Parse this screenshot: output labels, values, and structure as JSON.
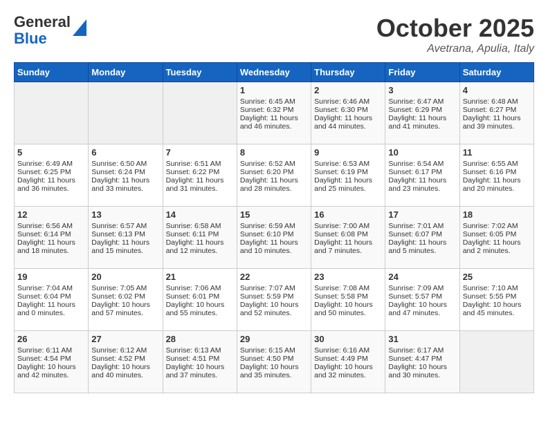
{
  "header": {
    "logo_line1": "General",
    "logo_line2": "Blue",
    "month": "October 2025",
    "location": "Avetrana, Apulia, Italy"
  },
  "days_of_week": [
    "Sunday",
    "Monday",
    "Tuesday",
    "Wednesday",
    "Thursday",
    "Friday",
    "Saturday"
  ],
  "weeks": [
    [
      {
        "day": "",
        "sunrise": "",
        "sunset": "",
        "daylight": ""
      },
      {
        "day": "",
        "sunrise": "",
        "sunset": "",
        "daylight": ""
      },
      {
        "day": "",
        "sunrise": "",
        "sunset": "",
        "daylight": ""
      },
      {
        "day": "1",
        "sunrise": "Sunrise: 6:45 AM",
        "sunset": "Sunset: 6:32 PM",
        "daylight": "Daylight: 11 hours and 46 minutes."
      },
      {
        "day": "2",
        "sunrise": "Sunrise: 6:46 AM",
        "sunset": "Sunset: 6:30 PM",
        "daylight": "Daylight: 11 hours and 44 minutes."
      },
      {
        "day": "3",
        "sunrise": "Sunrise: 6:47 AM",
        "sunset": "Sunset: 6:29 PM",
        "daylight": "Daylight: 11 hours and 41 minutes."
      },
      {
        "day": "4",
        "sunrise": "Sunrise: 6:48 AM",
        "sunset": "Sunset: 6:27 PM",
        "daylight": "Daylight: 11 hours and 39 minutes."
      }
    ],
    [
      {
        "day": "5",
        "sunrise": "Sunrise: 6:49 AM",
        "sunset": "Sunset: 6:25 PM",
        "daylight": "Daylight: 11 hours and 36 minutes."
      },
      {
        "day": "6",
        "sunrise": "Sunrise: 6:50 AM",
        "sunset": "Sunset: 6:24 PM",
        "daylight": "Daylight: 11 hours and 33 minutes."
      },
      {
        "day": "7",
        "sunrise": "Sunrise: 6:51 AM",
        "sunset": "Sunset: 6:22 PM",
        "daylight": "Daylight: 11 hours and 31 minutes."
      },
      {
        "day": "8",
        "sunrise": "Sunrise: 6:52 AM",
        "sunset": "Sunset: 6:20 PM",
        "daylight": "Daylight: 11 hours and 28 minutes."
      },
      {
        "day": "9",
        "sunrise": "Sunrise: 6:53 AM",
        "sunset": "Sunset: 6:19 PM",
        "daylight": "Daylight: 11 hours and 25 minutes."
      },
      {
        "day": "10",
        "sunrise": "Sunrise: 6:54 AM",
        "sunset": "Sunset: 6:17 PM",
        "daylight": "Daylight: 11 hours and 23 minutes."
      },
      {
        "day": "11",
        "sunrise": "Sunrise: 6:55 AM",
        "sunset": "Sunset: 6:16 PM",
        "daylight": "Daylight: 11 hours and 20 minutes."
      }
    ],
    [
      {
        "day": "12",
        "sunrise": "Sunrise: 6:56 AM",
        "sunset": "Sunset: 6:14 PM",
        "daylight": "Daylight: 11 hours and 18 minutes."
      },
      {
        "day": "13",
        "sunrise": "Sunrise: 6:57 AM",
        "sunset": "Sunset: 6:13 PM",
        "daylight": "Daylight: 11 hours and 15 minutes."
      },
      {
        "day": "14",
        "sunrise": "Sunrise: 6:58 AM",
        "sunset": "Sunset: 6:11 PM",
        "daylight": "Daylight: 11 hours and 12 minutes."
      },
      {
        "day": "15",
        "sunrise": "Sunrise: 6:59 AM",
        "sunset": "Sunset: 6:10 PM",
        "daylight": "Daylight: 11 hours and 10 minutes."
      },
      {
        "day": "16",
        "sunrise": "Sunrise: 7:00 AM",
        "sunset": "Sunset: 6:08 PM",
        "daylight": "Daylight: 11 hours and 7 minutes."
      },
      {
        "day": "17",
        "sunrise": "Sunrise: 7:01 AM",
        "sunset": "Sunset: 6:07 PM",
        "daylight": "Daylight: 11 hours and 5 minutes."
      },
      {
        "day": "18",
        "sunrise": "Sunrise: 7:02 AM",
        "sunset": "Sunset: 6:05 PM",
        "daylight": "Daylight: 11 hours and 2 minutes."
      }
    ],
    [
      {
        "day": "19",
        "sunrise": "Sunrise: 7:04 AM",
        "sunset": "Sunset: 6:04 PM",
        "daylight": "Daylight: 11 hours and 0 minutes."
      },
      {
        "day": "20",
        "sunrise": "Sunrise: 7:05 AM",
        "sunset": "Sunset: 6:02 PM",
        "daylight": "Daylight: 10 hours and 57 minutes."
      },
      {
        "day": "21",
        "sunrise": "Sunrise: 7:06 AM",
        "sunset": "Sunset: 6:01 PM",
        "daylight": "Daylight: 10 hours and 55 minutes."
      },
      {
        "day": "22",
        "sunrise": "Sunrise: 7:07 AM",
        "sunset": "Sunset: 5:59 PM",
        "daylight": "Daylight: 10 hours and 52 minutes."
      },
      {
        "day": "23",
        "sunrise": "Sunrise: 7:08 AM",
        "sunset": "Sunset: 5:58 PM",
        "daylight": "Daylight: 10 hours and 50 minutes."
      },
      {
        "day": "24",
        "sunrise": "Sunrise: 7:09 AM",
        "sunset": "Sunset: 5:57 PM",
        "daylight": "Daylight: 10 hours and 47 minutes."
      },
      {
        "day": "25",
        "sunrise": "Sunrise: 7:10 AM",
        "sunset": "Sunset: 5:55 PM",
        "daylight": "Daylight: 10 hours and 45 minutes."
      }
    ],
    [
      {
        "day": "26",
        "sunrise": "Sunrise: 6:11 AM",
        "sunset": "Sunset: 4:54 PM",
        "daylight": "Daylight: 10 hours and 42 minutes."
      },
      {
        "day": "27",
        "sunrise": "Sunrise: 6:12 AM",
        "sunset": "Sunset: 4:52 PM",
        "daylight": "Daylight: 10 hours and 40 minutes."
      },
      {
        "day": "28",
        "sunrise": "Sunrise: 6:13 AM",
        "sunset": "Sunset: 4:51 PM",
        "daylight": "Daylight: 10 hours and 37 minutes."
      },
      {
        "day": "29",
        "sunrise": "Sunrise: 6:15 AM",
        "sunset": "Sunset: 4:50 PM",
        "daylight": "Daylight: 10 hours and 35 minutes."
      },
      {
        "day": "30",
        "sunrise": "Sunrise: 6:16 AM",
        "sunset": "Sunset: 4:49 PM",
        "daylight": "Daylight: 10 hours and 32 minutes."
      },
      {
        "day": "31",
        "sunrise": "Sunrise: 6:17 AM",
        "sunset": "Sunset: 4:47 PM",
        "daylight": "Daylight: 10 hours and 30 minutes."
      },
      {
        "day": "",
        "sunrise": "",
        "sunset": "",
        "daylight": ""
      }
    ]
  ]
}
